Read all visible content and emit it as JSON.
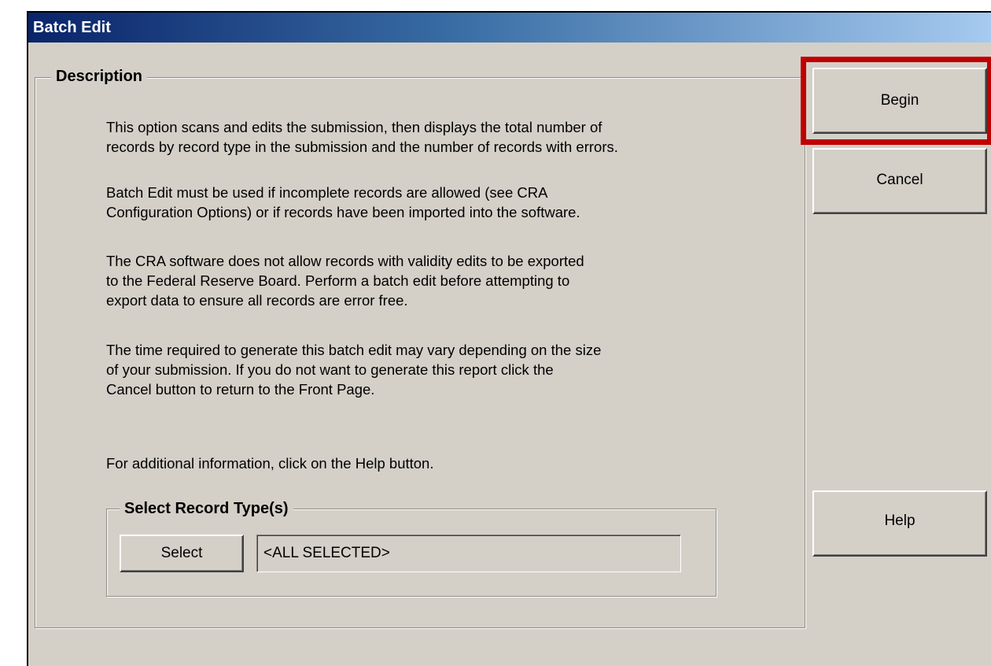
{
  "window": {
    "title": "Batch Edit"
  },
  "description": {
    "group_title": "Description",
    "paragraphs": [
      "This option scans and edits the submission, then displays the total number of\nrecords by record type in the submission and the number of records with errors.",
      "Batch Edit must be used if incomplete records are allowed (see CRA\nConfiguration Options) or if records have been imported into the software.",
      "The CRA software does not allow records with validity edits to be exported\nto the Federal Reserve Board.  Perform a batch edit before attempting to\nexport data to ensure all records are error free.",
      "The time required to generate this batch edit may vary depending on the size\nof your submission.  If you do not want to generate this report click the\nCancel button to return to the Front Page.",
      "For additional information, click on the Help button."
    ]
  },
  "record_type": {
    "group_title": "Select Record Type(s)",
    "select_label": "Select",
    "value": "<ALL SELECTED>"
  },
  "buttons": {
    "begin": "Begin",
    "cancel": "Cancel",
    "help": "Help"
  },
  "colors": {
    "highlight": "#c00000",
    "dialog_background": "#d4d0c8",
    "title_gradient_start": "#0a246a",
    "title_gradient_end": "#a6caf0"
  }
}
